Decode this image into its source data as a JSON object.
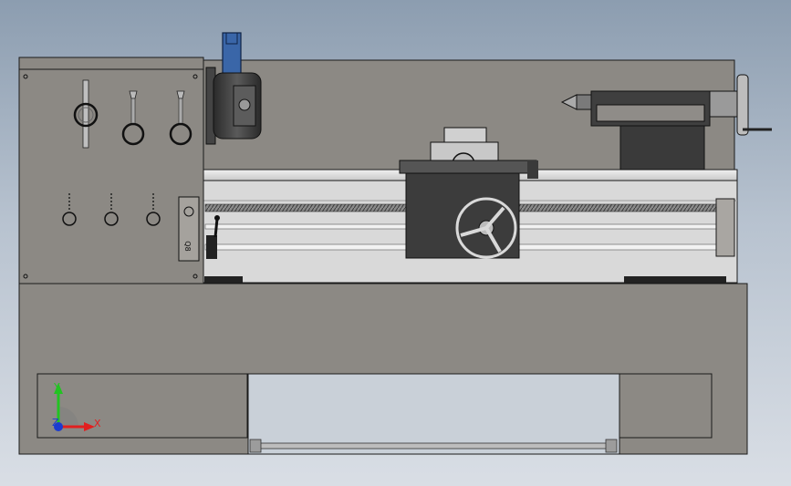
{
  "colors": {
    "body": "#8c8984",
    "body_dark": "#6f6c68",
    "outline": "#1a1a1a",
    "rail": "#d6d6d6",
    "metal_dark": "#3a3a3a",
    "chuck_blue": "#3a66a8",
    "x_axis": "#e21f1f",
    "y_axis": "#22c322",
    "z_axis": "#1b3ccf"
  },
  "triad": {
    "x_label": "X",
    "y_label": "Y",
    "z_label": "Z"
  },
  "headstock": {
    "plate_label": "Q8"
  },
  "icons": [
    "coordinate-triad-icon"
  ]
}
